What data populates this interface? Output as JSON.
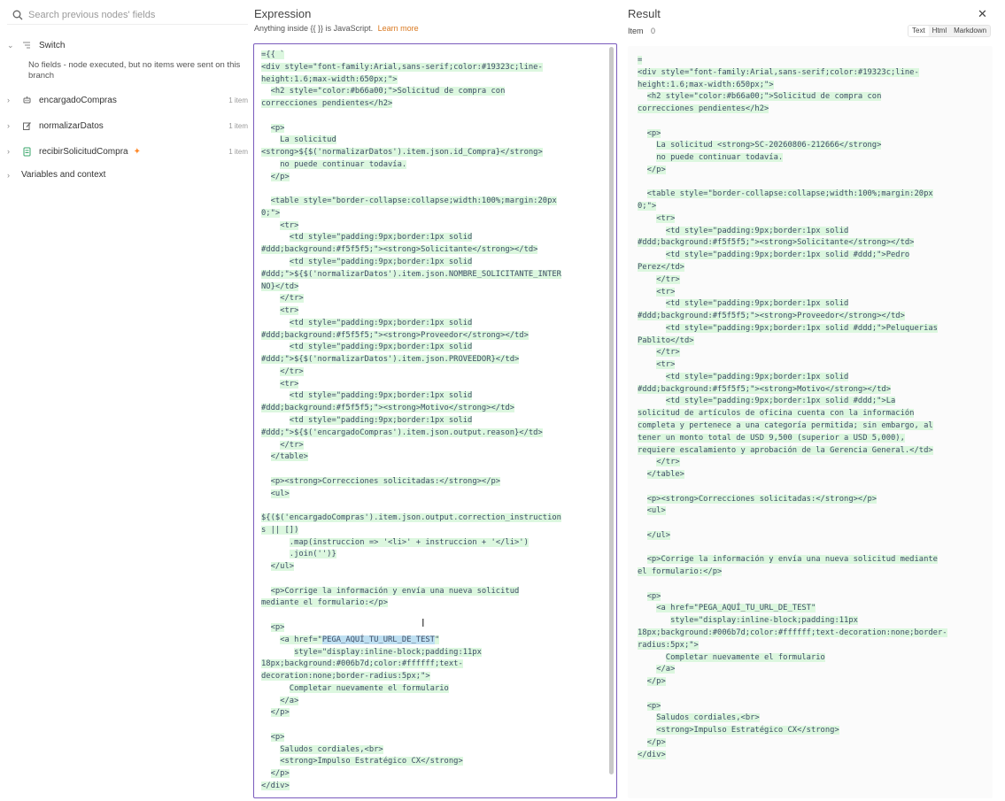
{
  "left_panel": {
    "search_placeholder": "Search previous nodes' fields",
    "nodes": [
      {
        "name": "Switch",
        "count": "",
        "icon": "switch-icon"
      },
      {
        "name": "encargadoCompras",
        "count": "1 item",
        "icon": "robot-icon"
      },
      {
        "name": "normalizarDatos",
        "count": "1 item",
        "icon": "edit-icon"
      },
      {
        "name": "recibirSolicitudCompra",
        "count": "1 item",
        "icon": "form-icon"
      }
    ],
    "no_fields_message": "No fields - node executed, but no items were sent on this branch",
    "variables_label": "Variables and context"
  },
  "expression": {
    "title": "Expression",
    "subtitle": "Anything inside {{ }} is JavaScript.",
    "learn_more": "Learn more",
    "lines": [
      "={{ `",
      "<div style=\"font-family:Arial,sans-serif;color:#19323c;line-",
      "height:1.6;max-width:650px;\">",
      "  <h2 style=\"color:#b66a00;\">Solicitud de compra con",
      "correcciones pendientes</h2>",
      "",
      "  <p>",
      "    La solicitud",
      "<strong>${$('normalizarDatos').item.json.id_Compra}</strong>",
      "    no puede continuar todavía.",
      "  </p>",
      "",
      "  <table style=\"border-collapse:collapse;width:100%;margin:20px",
      "0;\">",
      "    <tr>",
      "      <td style=\"padding:9px;border:1px solid",
      "#ddd;background:#f5f5f5;\"><strong>Solicitante</strong></td>",
      "      <td style=\"padding:9px;border:1px solid",
      "#ddd;\">${$('normalizarDatos').item.json.NOMBRE_SOLICITANTE_INTER",
      "NO}</td>",
      "    </tr>",
      "    <tr>",
      "      <td style=\"padding:9px;border:1px solid",
      "#ddd;background:#f5f5f5;\"><strong>Proveedor</strong></td>",
      "      <td style=\"padding:9px;border:1px solid",
      "#ddd;\">${$('normalizarDatos').item.json.PROVEEDOR}</td>",
      "    </tr>",
      "    <tr>",
      "      <td style=\"padding:9px;border:1px solid",
      "#ddd;background:#f5f5f5;\"><strong>Motivo</strong></td>",
      "      <td style=\"padding:9px;border:1px solid",
      "#ddd;\">${$('encargadoCompras').item.json.output.reason}</td>",
      "    </tr>",
      "  </table>",
      "",
      "  <p><strong>Correcciones solicitadas:</strong></p>",
      "  <ul>",
      "",
      "${($('encargadoCompras').item.json.output.correction_instruction",
      "s || [])",
      "      .map(instruccion => '<li>' + instruccion + '</li>')",
      "      .join('')}",
      "  </ul>",
      "",
      "  <p>Corrige la información y envía una nueva solicitud",
      "mediante el formulario:</p>",
      "",
      "  <p>",
      "    <a href=\"PEGA_AQUÍ_TU_URL_DE_TEST\"",
      "       style=\"display:inline-block;padding:11px",
      "18px;background:#006b7d;color:#ffffff;text-",
      "decoration:none;border-radius:5px;\">",
      "      Completar nuevamente el formulario",
      "    </a>",
      "  </p>",
      "",
      "  <p>",
      "    Saludos cordiales,<br>",
      "    <strong>Impulso Estratégico CX</strong>",
      "  </p>",
      "</div>"
    ]
  },
  "result": {
    "title": "Result",
    "item_label": "Item",
    "item_control": "0",
    "view_modes": [
      "Text",
      "Html",
      "Markdown"
    ],
    "active_view": "Text",
    "lines": [
      "=",
      "<div style=\"font-family:Arial,sans-serif;color:#19323c;line-",
      "height:1.6;max-width:650px;\">",
      "  <h2 style=\"color:#b66a00;\">Solicitud de compra con",
      "correcciones pendientes</h2>",
      "",
      "  <p>",
      "    La solicitud <strong>SC-20260806-212666</strong>",
      "    no puede continuar todavía.",
      "  </p>",
      "",
      "  <table style=\"border-collapse:collapse;width:100%;margin:20px",
      "0;\">",
      "    <tr>",
      "      <td style=\"padding:9px;border:1px solid",
      "#ddd;background:#f5f5f5;\"><strong>Solicitante</strong></td>",
      "      <td style=\"padding:9px;border:1px solid #ddd;\">Pedro",
      "Perez</td>",
      "    </tr>",
      "    <tr>",
      "      <td style=\"padding:9px;border:1px solid",
      "#ddd;background:#f5f5f5;\"><strong>Proveedor</strong></td>",
      "      <td style=\"padding:9px;border:1px solid #ddd;\">Peluquerias",
      "Pablito</td>",
      "    </tr>",
      "    <tr>",
      "      <td style=\"padding:9px;border:1px solid",
      "#ddd;background:#f5f5f5;\"><strong>Motivo</strong></td>",
      "      <td style=\"padding:9px;border:1px solid #ddd;\">La",
      "solicitud de artículos de oficina cuenta con la información",
      "completa y pertenece a una categoría permitida; sin embargo, al",
      "tener un monto total de USD 9,500 (superior a USD 5,000),",
      "requiere escalamiento y aprobación de la Gerencia General.</td>",
      "    </tr>",
      "  </table>",
      "",
      "  <p><strong>Correcciones solicitadas:</strong></p>",
      "  <ul>",
      "",
      "  </ul>",
      "",
      "  <p>Corrige la información y envía una nueva solicitud mediante",
      "el formulario:</p>",
      "",
      "  <p>",
      "    <a href=\"PEGA_AQUÍ_TU_URL_DE_TEST\"",
      "       style=\"display:inline-block;padding:11px",
      "18px;background:#006b7d;color:#ffffff;text-decoration:none;border-",
      "radius:5px;\">",
      "      Completar nuevamente el formulario",
      "    </a>",
      "  </p>",
      "",
      "  <p>",
      "    Saludos cordiales,<br>",
      "    <strong>Impulso Estratégico CX</strong>",
      "  </p>",
      "</div>"
    ]
  },
  "colors": {
    "accent_orange": "#d9781f",
    "editor_border": "#7a5bbd",
    "code_highlight": "#dcf7df",
    "selection": "#bfe0f2"
  }
}
